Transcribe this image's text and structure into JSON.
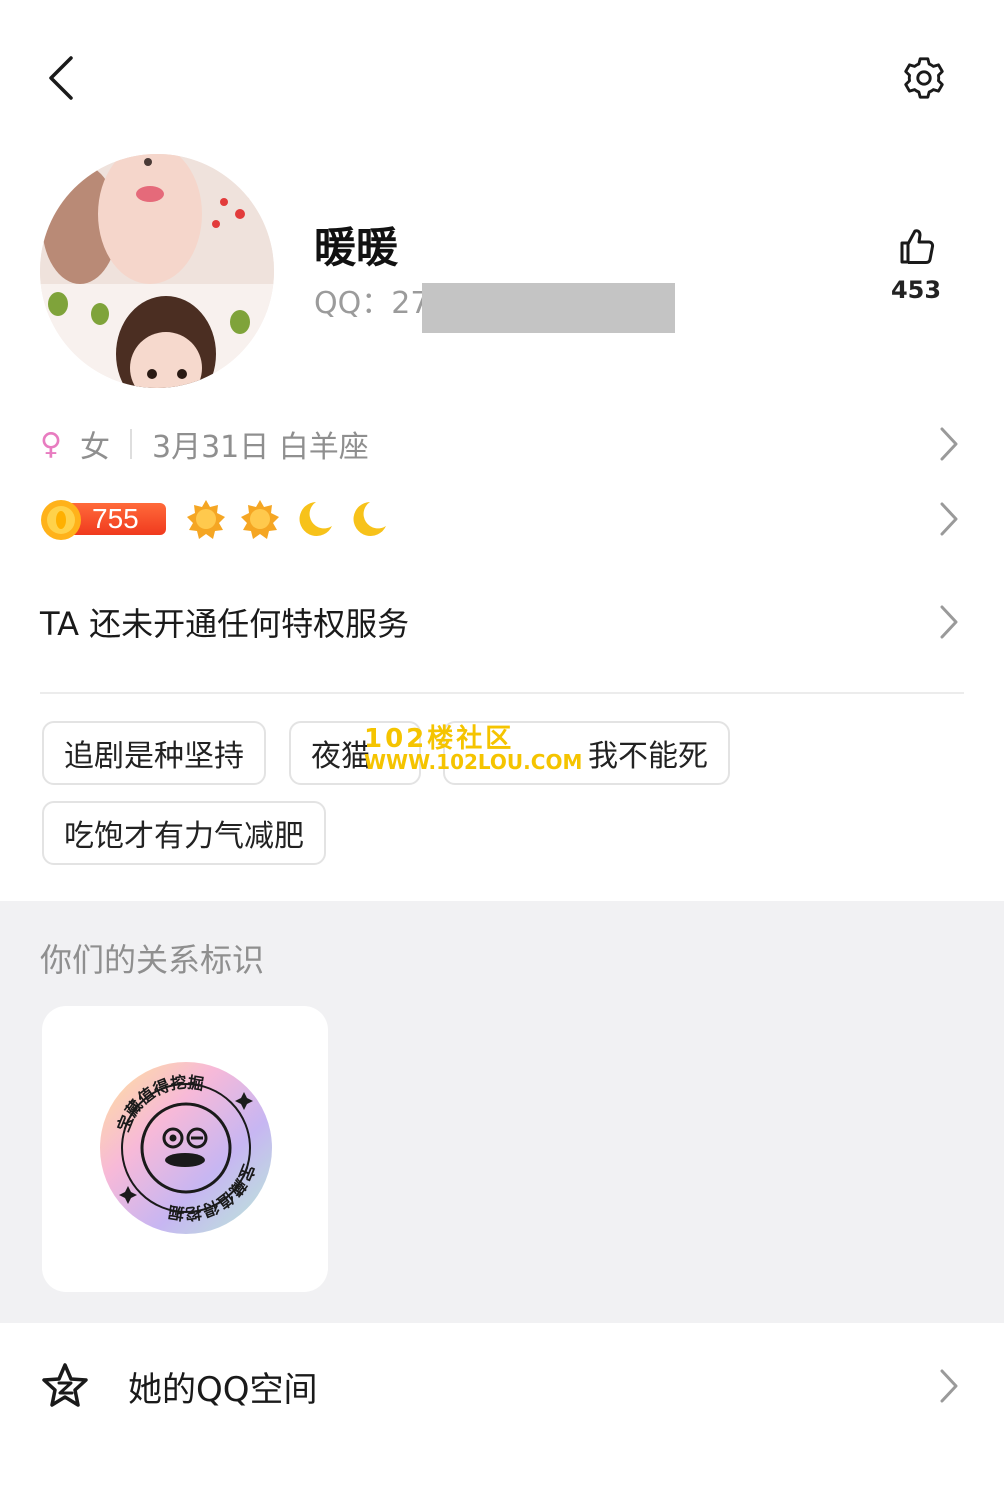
{
  "header": {
    "back_icon": "chevron-left-icon",
    "settings_icon": "gear-icon"
  },
  "profile": {
    "nickname": "暖暖",
    "qq_label": "QQ：27",
    "likes": "453",
    "like_icon": "thumbs-up-icon",
    "avatar": "photo-collage-avatar"
  },
  "info": {
    "gender_icon": "♀",
    "gender": "女",
    "birthday": "3月31日 白羊座"
  },
  "level": {
    "value": "755",
    "icons": [
      "sun-icon",
      "sun-icon",
      "moon-icon",
      "moon-icon"
    ]
  },
  "privilege": {
    "text": "TA 还未开通任何特权服务"
  },
  "tags": [
    {
      "label": "追剧是种坚持"
    },
    {
      "label": "夜猫"
    },
    {
      "label": "我不能死"
    },
    {
      "label": "吃饱才有力气减肥"
    }
  ],
  "watermark": {
    "line1": "102楼社区",
    "line2": "WWW.102LOU.COM"
  },
  "relationship": {
    "title": "你们的关系标识",
    "badge_text": "宝藏值得挖掘"
  },
  "qzone": {
    "label": "她的QQ空间",
    "icon": "star-icon"
  },
  "colors": {
    "accent_pink": "#e87cc0",
    "level_red": "#f03a1e",
    "sun": "#f5a623",
    "moon": "#f7c21a",
    "section_bg": "#f1f1f3"
  }
}
